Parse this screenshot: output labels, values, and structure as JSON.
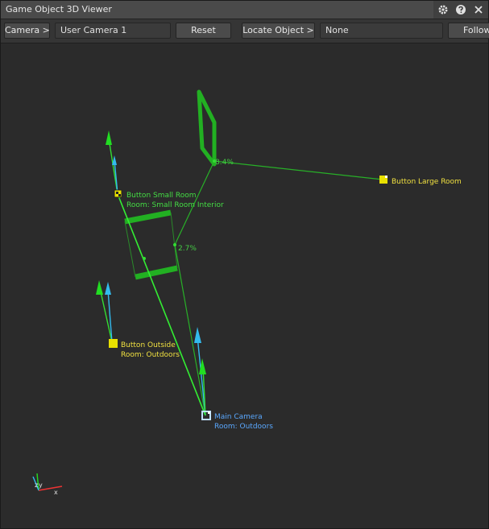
{
  "window": {
    "title": "Game Object 3D Viewer"
  },
  "title_icons": {
    "settings": "gear-icon",
    "help": "help-icon",
    "close": "close-icon"
  },
  "toolbar": {
    "camera_label": "Camera >",
    "camera_value": "User Camera 1",
    "reset_label": "Reset",
    "locate_label": "Locate Object >",
    "locate_value": "None",
    "follow_label": "Follow"
  },
  "scene": {
    "objects": {
      "small_room": {
        "name": "Button Small Room",
        "room": "Room: Small Room Interior"
      },
      "large_room": {
        "name": "Button Large Room"
      },
      "outside": {
        "name": "Button Outside",
        "room": "Room: Outdoors"
      },
      "camera": {
        "name": "Main Camera",
        "room": "Room: Outdoors"
      }
    },
    "percent_labels": {
      "upper": "8.4%",
      "lower": "2.7%"
    },
    "axes": {
      "y": "y",
      "z": "z",
      "x": "x"
    }
  },
  "colors": {
    "green_geometry": "#22c022",
    "bright_green": "#33ee33",
    "cyan": "#33bbee",
    "yellow_marker": "#e8e000",
    "yellow_text": "#f0e040",
    "green_text": "#44dd44",
    "blue_text": "#5aa8ff"
  }
}
